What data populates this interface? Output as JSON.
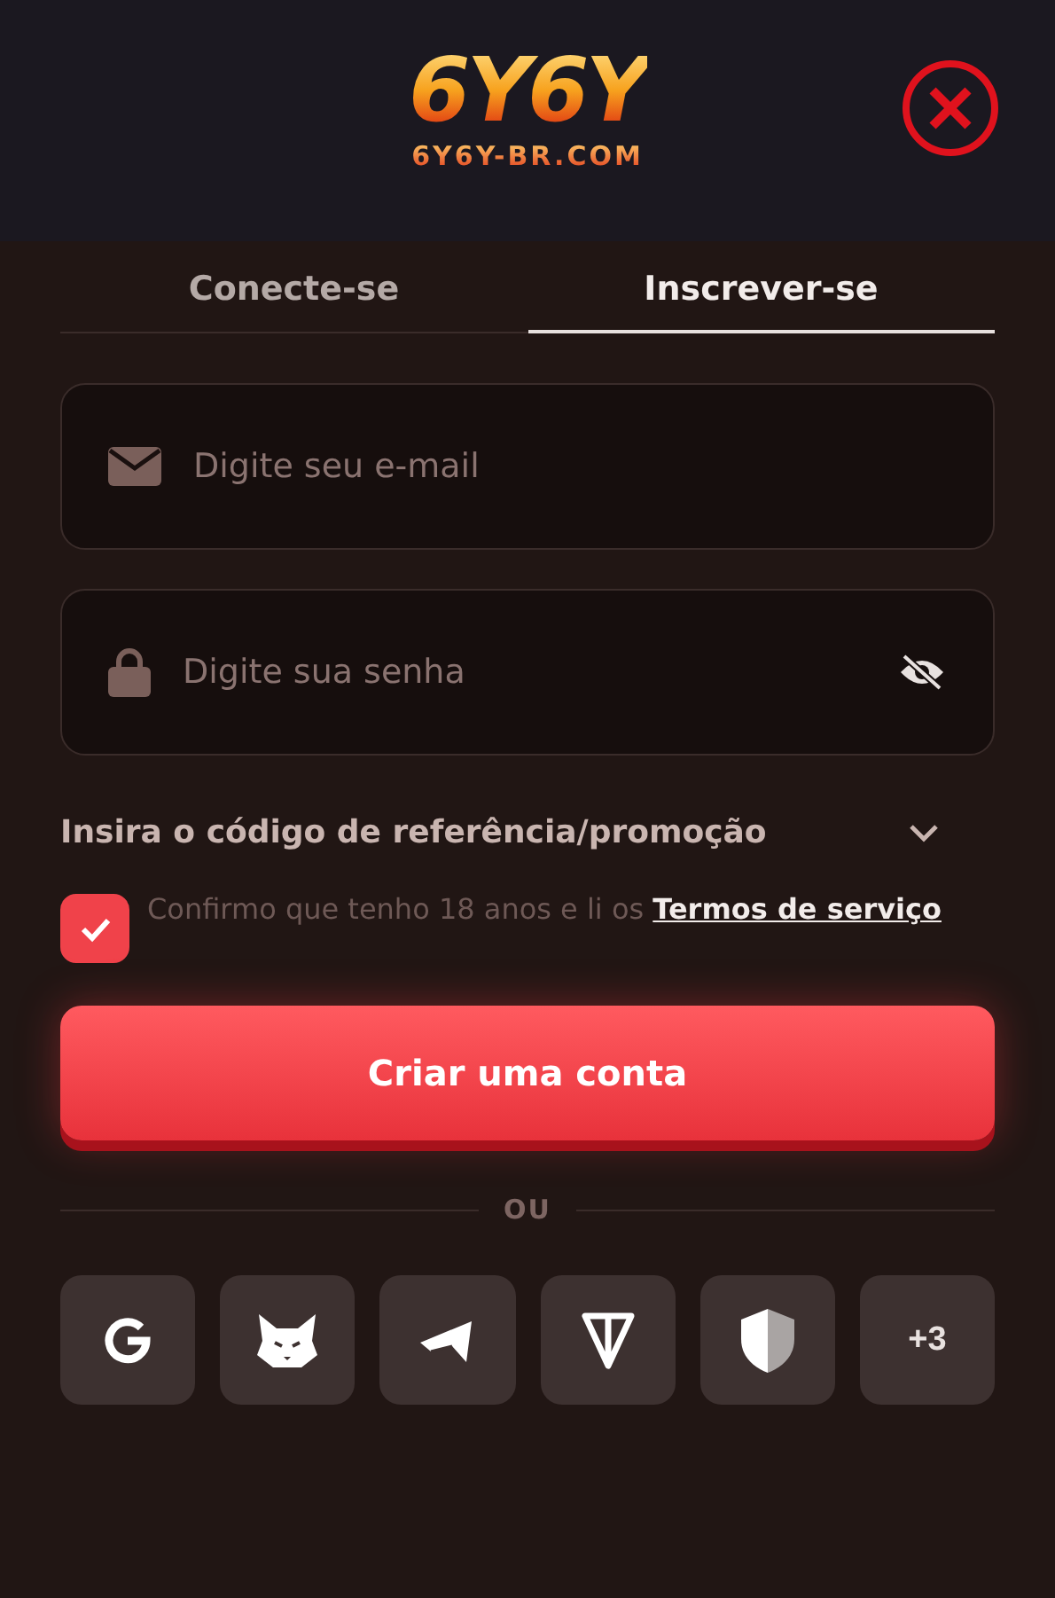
{
  "logo": {
    "title": "6Y6Y",
    "domain": "6Y6Y-BR.COM"
  },
  "tabs": [
    {
      "label": "Conecte-se",
      "selected": false
    },
    {
      "label": "Inscrever-se",
      "selected": true
    }
  ],
  "fields": [
    {
      "kind": "email",
      "placeholder": "Digite seu e-mail"
    },
    {
      "kind": "password",
      "placeholder": "Digite sua senha"
    }
  ],
  "referral": {
    "label": "Insira o código de referência/promoção",
    "expanded": false
  },
  "consent": {
    "checked": true,
    "text": "Confirmo que tenho 18 anos e li os",
    "link": "Termos de serviço"
  },
  "submit": "Criar uma conta",
  "divider": "OU",
  "social": [
    {
      "kind": "google"
    },
    {
      "kind": "fox"
    },
    {
      "kind": "telegram"
    },
    {
      "kind": "ton"
    },
    {
      "kind": "shield"
    },
    {
      "kind": "more",
      "label": "+3"
    }
  ]
}
